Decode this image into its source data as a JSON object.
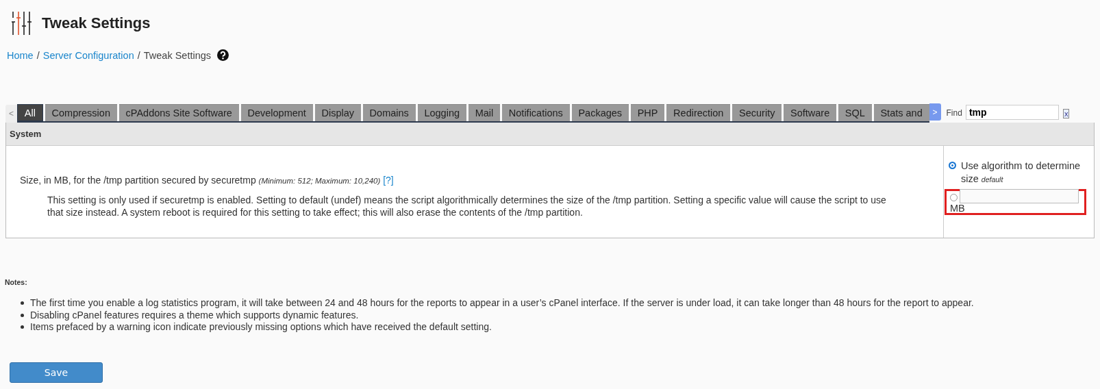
{
  "page": {
    "title": "Tweak Settings"
  },
  "breadcrumb_separator": "/",
  "breadcrumb": [
    {
      "label": "Home",
      "link": true
    },
    {
      "label": "Server Configuration",
      "link": true
    },
    {
      "label": "Tweak Settings",
      "link": false
    }
  ],
  "tabs": {
    "prev": "<",
    "next": ">",
    "items": [
      {
        "label": "All",
        "selected": true
      },
      {
        "label": "Compression",
        "selected": false
      },
      {
        "label": "cPAddons Site Software",
        "selected": false
      },
      {
        "label": "Development",
        "selected": false
      },
      {
        "label": "Display",
        "selected": false
      },
      {
        "label": "Domains",
        "selected": false
      },
      {
        "label": "Logging",
        "selected": false
      },
      {
        "label": "Mail",
        "selected": false
      },
      {
        "label": "Notifications",
        "selected": false
      },
      {
        "label": "Packages",
        "selected": false
      },
      {
        "label": "PHP",
        "selected": false
      },
      {
        "label": "Redirection",
        "selected": false
      },
      {
        "label": "Security",
        "selected": false
      },
      {
        "label": "Software",
        "selected": false
      },
      {
        "label": "SQL",
        "selected": false
      },
      {
        "label": "Stats and",
        "selected": false
      }
    ]
  },
  "find": {
    "label": "Find",
    "value": "tmp",
    "clear": "x"
  },
  "section": {
    "title": "System",
    "setting": {
      "label": "Size, in MB, for the /tmp partition secured by securetmp",
      "range": "(Minimum: 512; Maximum: 10,240)",
      "help": "[?]",
      "description": "This setting is only used if securetmp is enabled. Setting to default (undef) means the script algorithmically determines the size of the /tmp partition. Setting a specific value will cause the script to use that size instead. A system reboot is required for this setting to take effect; this will also erase the contents of the /tmp partition.",
      "options": [
        {
          "kind": "default",
          "label": "Use algorithm to determine size",
          "note": "default",
          "selected": true,
          "highlighted": false
        },
        {
          "kind": "custom",
          "unit": "MB",
          "selected": false,
          "highlighted": true
        }
      ]
    }
  },
  "notes": {
    "title": "Notes:",
    "items": [
      "The first time you enable a log statistics program, it will take between 24 and 48 hours for the reports to appear in a user’s cPanel interface. If the server is under load, it can take longer than 48 hours for the report to appear.",
      "Disabling cPanel features requires a theme which supports dynamic features.",
      "Items prefaced by a warning icon indicate previously missing options which have received the default setting."
    ]
  },
  "save": "Save"
}
